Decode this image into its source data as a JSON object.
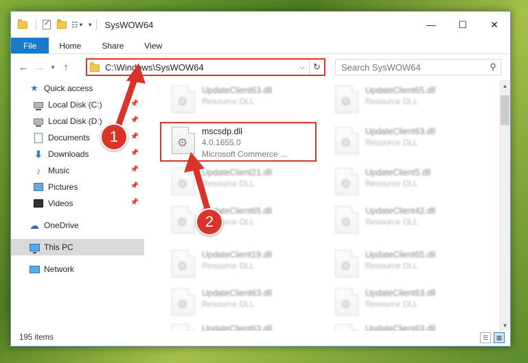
{
  "window": {
    "title": "SysWOW64",
    "controls": {
      "minimize": "—",
      "maximize": "☐",
      "close": "✕"
    }
  },
  "ribbon": {
    "tabs": [
      {
        "label": "File"
      },
      {
        "label": "Home"
      },
      {
        "label": "Share"
      },
      {
        "label": "View"
      }
    ]
  },
  "address": {
    "path": "C:\\Windows\\SysWOW64"
  },
  "search": {
    "placeholder": "Search SysWOW64"
  },
  "sidebar": {
    "quick_access": "Quick access",
    "items": [
      {
        "label": "Local Disk (C:)"
      },
      {
        "label": "Local Disk (D:)"
      },
      {
        "label": "Documents"
      },
      {
        "label": "Downloads"
      },
      {
        "label": "Music"
      },
      {
        "label": "Pictures"
      },
      {
        "label": "Videos"
      }
    ],
    "onedrive": "OneDrive",
    "thispc": "This PC",
    "network": "Network"
  },
  "files": {
    "highlighted": {
      "name": "mscsdp.dll",
      "version": "4.0.1655.0",
      "company": "Microsoft Commerce ..."
    },
    "left": [
      {
        "name": "UpdateClient63.dll",
        "type": "Resource DLL"
      },
      {
        "name": "UpdateClient21.dll",
        "type": "Resource DLL"
      },
      {
        "name": "UpdateClient65.dll",
        "type": "Resource DLL"
      },
      {
        "name": "UpdateClient19.dll",
        "type": "Resource DLL"
      },
      {
        "name": "UpdateClient63.dll",
        "type": "Resource DLL"
      },
      {
        "name": "UpdateClient63.dll",
        "type": "Resource DLL"
      }
    ],
    "right": [
      {
        "name": "UpdateClient65.dll",
        "type": "Resource DLL"
      },
      {
        "name": "UpdateClient63.dll",
        "type": "Resource DLL"
      },
      {
        "name": "UpdateClient5.dll",
        "type": "Resource DLL"
      },
      {
        "name": "UpdateClient42.dll",
        "type": "Resource DLL"
      },
      {
        "name": "UpdateClient65.dll",
        "type": "Resource DLL"
      },
      {
        "name": "UpdateClient63.dll",
        "type": "Resource DLL"
      },
      {
        "name": "UpdateClient63.dll",
        "type": "Resource DLL"
      }
    ]
  },
  "status": {
    "count": "195 items"
  },
  "callouts": {
    "one": "1",
    "two": "2"
  },
  "colors": {
    "accent": "#1979ca",
    "highlight": "#d9332a"
  }
}
